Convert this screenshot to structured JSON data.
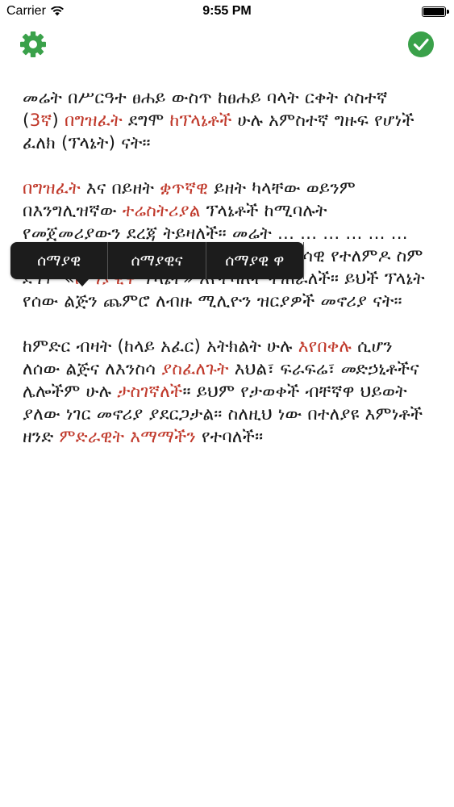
{
  "status": {
    "carrier": "Carrier",
    "time": "9:55 PM",
    "battery_level": 1.0
  },
  "nav": {
    "left_icon": "gear-icon",
    "right_icon": "checkmark-circle-icon",
    "accent_color": "#3aa14a"
  },
  "article": {
    "highlight_color": "#c0392b",
    "paragraphs": [
      [
        {
          "text": "መሬት በሥርዓተ ፀሐይ ውስጥ ከፀሐይ ባላት ርቀት ሶስተኛ (",
          "hl": false
        },
        {
          "text": "3ኛ",
          "hl": true
        },
        {
          "text": ") ",
          "hl": false
        },
        {
          "text": "በግዝፈት",
          "hl": true
        },
        {
          "text": " ደግሞ ",
          "hl": false
        },
        {
          "text": "ከፕላኔቶች",
          "hl": true
        },
        {
          "text": " ሁሉ አምስተኛ ግዙፍ የሆነች ፈለክ (ፕላኔት) ናት።",
          "hl": false
        }
      ],
      [
        {
          "text": "በግዝፈት",
          "hl": true
        },
        {
          "text": " እና በይዘት ",
          "hl": false
        },
        {
          "text": "ቋጥኛዊ",
          "hl": true
        },
        {
          "text": " ይዘት ካላቸው ወይንም በእንግሊዝኛው ",
          "hl": false
        },
        {
          "text": "ተሬስትሪያል",
          "hl": true
        },
        {
          "text": " ፕላኔቶች ከሚባሉት የመጀመሪያውን ደረጃ ትይዛለች። መሬት ... ... ... ... ... ... ... ... ... ... ... ትባለች ትጠራለች። በሳይንሳዊ የተለምዶ ስም ደግሞ «",
          "hl": false
        },
        {
          "text": "ሰማያዊዋ",
          "hl": true
        },
        {
          "text": " ፕላኔት» እየተባለች ትጠራለች። ይህች ፕላኔት የሰው ልጅን ጨምሮ ለብዙ ሚሊዮን ዝርያዎች መኖሪያ ናት።",
          "hl": false
        }
      ],
      [
        {
          "text": "ከምድር ብዛት (ከላይ አፈር) አትክልት ሁሉ ",
          "hl": false
        },
        {
          "text": "እየበቀሉ",
          "hl": true
        },
        {
          "text": " ሲሆን ለሰው ልጅና ለእንስሳ ",
          "hl": false
        },
        {
          "text": "ያስፈለጉት",
          "hl": true
        },
        {
          "text": " እህል፣ ፍራፍሬ፣ መድኃኒቶችና ሌሎችም ሁሉ ",
          "hl": false
        },
        {
          "text": "ታስገኛለች",
          "hl": true
        },
        {
          "text": "። ይህም የታወቀች ብቸኛዋ ህይወት ያለው ነገር መኖሪያ ያደርጋታል። ስለዚህ ነው በተለያዩ እምነቶች ዘንድ ",
          "hl": false
        },
        {
          "text": "ምድራዊት",
          "hl": true
        },
        {
          "text": " ",
          "hl": false
        },
        {
          "text": "እማማችን",
          "hl": true
        },
        {
          "text": " የተባለች።",
          "hl": false
        }
      ]
    ]
  },
  "suggestion_menu": {
    "items": [
      "ሰማያዊ",
      "ሰማያዊና",
      "ሰማያዊ ዋ"
    ]
  }
}
